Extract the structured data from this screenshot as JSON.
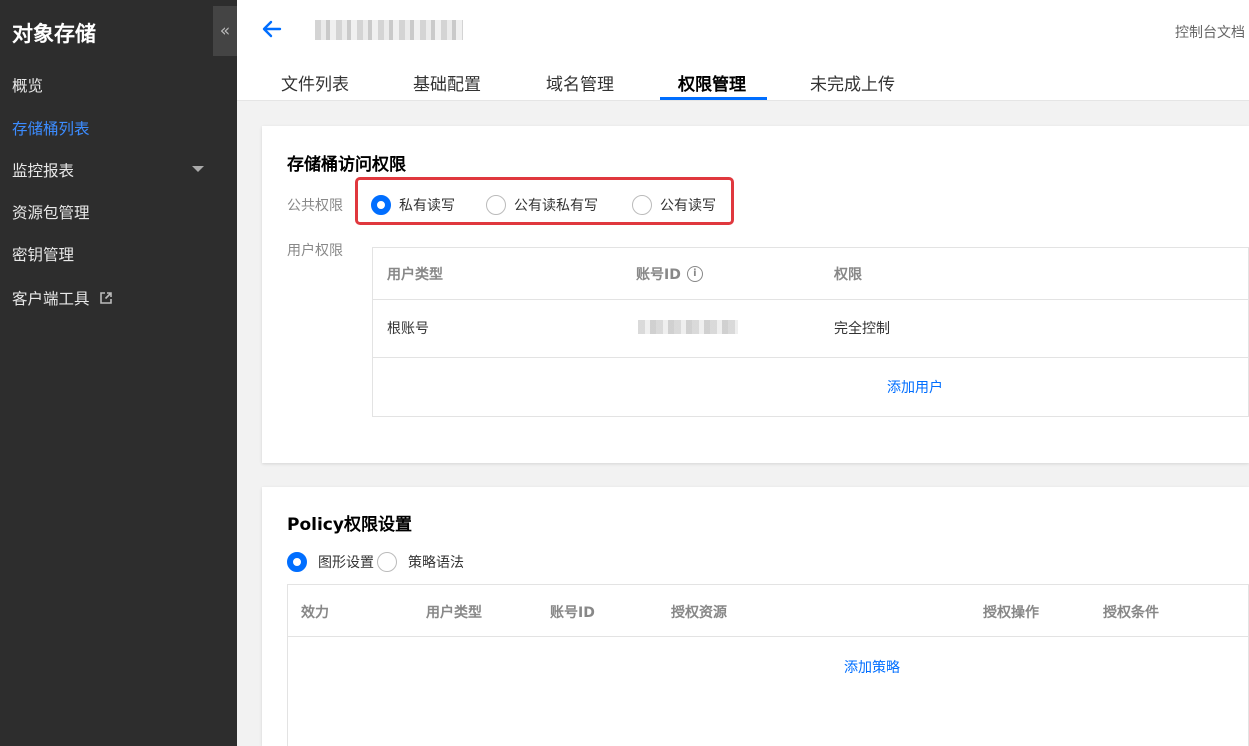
{
  "sidebar": {
    "title": "对象存储",
    "collapse_glyph": "«",
    "items": [
      {
        "label": "概览"
      },
      {
        "label": "存储桶列表"
      },
      {
        "label": "监控报表"
      },
      {
        "label": "资源包管理"
      },
      {
        "label": "密钥管理"
      },
      {
        "label": "客户端工具"
      }
    ]
  },
  "header": {
    "doc_link": "控制台文档",
    "tabs": [
      {
        "label": "文件列表"
      },
      {
        "label": "基础配置"
      },
      {
        "label": "域名管理"
      },
      {
        "label": "权限管理"
      },
      {
        "label": "未完成上传"
      }
    ]
  },
  "bucket_acl": {
    "title": "存储桶访问权限",
    "public_label": "公共权限",
    "options": [
      {
        "label": "私有读写"
      },
      {
        "label": "公有读私有写"
      },
      {
        "label": "公有读写"
      }
    ],
    "user_label": "用户权限",
    "columns": [
      "用户类型",
      "账号ID",
      "权限"
    ],
    "rows": [
      {
        "user_type": "根账号",
        "permission": "完全控制"
      }
    ],
    "add_user": "添加用户"
  },
  "policy": {
    "title": "Policy权限设置",
    "modes": [
      {
        "label": "图形设置"
      },
      {
        "label": "策略语法"
      }
    ],
    "columns": [
      "效力",
      "用户类型",
      "账号ID",
      "授权资源",
      "授权操作",
      "授权条件"
    ],
    "add_policy": "添加策略"
  },
  "colors": {
    "accent": "#006eff",
    "sidebar_bg": "#2d2d2d",
    "highlight": "#e0383e"
  }
}
